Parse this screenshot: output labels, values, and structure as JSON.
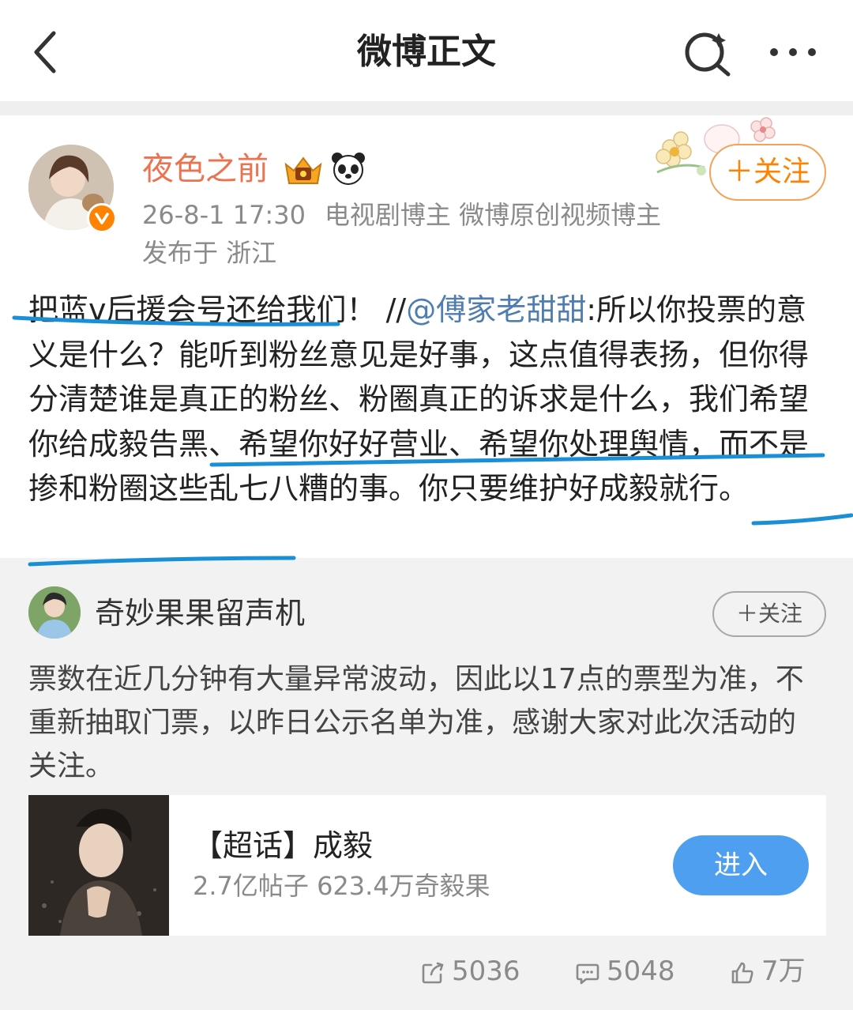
{
  "header": {
    "title": "微博正文"
  },
  "post": {
    "username": "夜色之前",
    "follow_label": "＋关注",
    "time": "26-8-1 17:30",
    "tags": "电视剧博主 微博原创视频博主",
    "location": "发布于 浙江",
    "text_part1": "把蓝v后援会号还给我们！ //",
    "mention": "@傅家老甜甜",
    "text_part2": ":所以你投票的意义是什么？能听到粉丝意见是好事，这点值得表扬，但你得分清楚谁是真正的粉丝、粉圈真正的诉求是什么，我们希望你给成毅告黑、希望你好好营业、希望你处理舆情，而不是掺和粉圈这些乱七八糟的事。你只要维护好成毅就行。"
  },
  "repost": {
    "username": "奇妙果果留声机",
    "follow_label": "＋关注",
    "text": "票数在近几分钟有大量异常波动，因此以17点的票型为准，不重新抽取门票，以昨日公示名单为准，感谢大家对此次活动的关注。",
    "card": {
      "title": "【超话】成毅",
      "subtitle": "2.7亿帖子 623.4万奇毅果",
      "button": "进入"
    }
  },
  "actions": {
    "repost_count": "5036",
    "comment_count": "5048",
    "like_count": "7万"
  },
  "colors": {
    "username": "#eb7350",
    "mention": "#507daf",
    "follow": "#ff8200",
    "enter_button": "#4f9ff0",
    "pen_underline": "#1a8fd6"
  }
}
